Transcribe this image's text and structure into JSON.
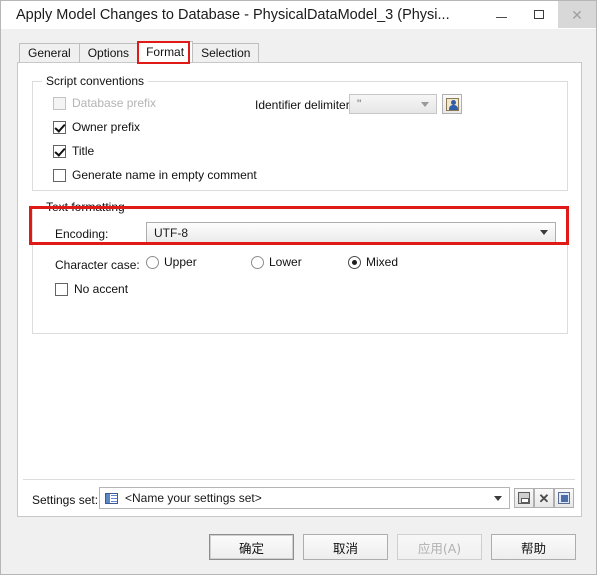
{
  "window": {
    "title": "Apply Model Changes to Database - PhysicalDataModel_3 (Physi...",
    "minimize_label": "Minimize",
    "maximize_label": "Maximize",
    "close_label": "Close"
  },
  "tabs": [
    {
      "label": "General",
      "active": false
    },
    {
      "label": "Options",
      "active": false
    },
    {
      "label": "Format",
      "active": true
    },
    {
      "label": "Selection",
      "active": false
    }
  ],
  "script_conventions": {
    "group_title": "Script conventions",
    "database_prefix": {
      "label": "Database prefix",
      "checked": false,
      "disabled": true
    },
    "owner_prefix": {
      "label": "Owner prefix",
      "checked": true
    },
    "title": {
      "label": "Title",
      "checked": true
    },
    "generate_name": {
      "label": "Generate name in empty comment",
      "checked": false
    },
    "identifier_delimiter": {
      "label": "Identifier delimiter:",
      "value": "\"",
      "disabled": true
    },
    "delimiter_button_icon": "user-properties-icon"
  },
  "text_formatting": {
    "group_title": "Text formatting",
    "encoding": {
      "label": "Encoding:",
      "value": "UTF-8"
    },
    "character_case": {
      "label": "Character case:",
      "options": [
        {
          "label": "Upper",
          "selected": false
        },
        {
          "label": "Lower",
          "selected": false
        },
        {
          "label": "Mixed",
          "selected": true
        }
      ]
    },
    "no_accent": {
      "label": "No accent",
      "checked": false
    }
  },
  "settings_set": {
    "label": "Settings set:",
    "value": "<Name your settings set>",
    "icon": "settings-set-icon",
    "save_icon": "save-icon",
    "delete_icon": "delete-icon",
    "properties_icon": "properties-icon"
  },
  "footer": {
    "ok": "确定",
    "cancel": "取消",
    "apply": "应用(A)",
    "help": "帮助",
    "apply_disabled": true
  },
  "annotations": {
    "tab_highlight_color": "#e01b17",
    "encoding_highlight_color": "#e01b17"
  }
}
